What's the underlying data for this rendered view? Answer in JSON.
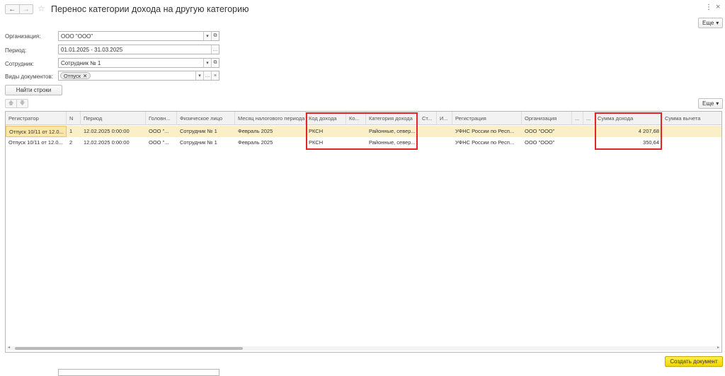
{
  "header": {
    "title": "Перенос категории дохода на другую категорию",
    "more_label": "Еще"
  },
  "form": {
    "organization": {
      "label": "Организация:",
      "value": "ООО \"ООО\""
    },
    "period": {
      "label": "Период:",
      "value": "01.01.2025 - 31.03.2025"
    },
    "employee": {
      "label": "Сотрудник:",
      "value": "Сотрудник № 1"
    },
    "doc_types": {
      "label": "Виды документов:",
      "tag": "Отпуск"
    }
  },
  "find_button": "Найти строки",
  "table_more_label": "Еще",
  "table": {
    "columns": [
      "Регистратор",
      "N",
      "Период",
      "Головн...",
      "Физическое лицо",
      "Месяц налогового периода",
      "Код дохода",
      "Ко...",
      "Категория дохода",
      "Ст...",
      "И...",
      "Регистрация",
      "Организация",
      "...",
      "...",
      "Сумма дохода",
      "Сумма вычета"
    ],
    "rows": [
      [
        "Отпуск 10/11 от 12.0...",
        "1",
        "12.02.2025 0:00:00",
        "ООО \"...",
        "Сотрудник № 1",
        "Февраль 2025",
        "РКСН",
        "",
        "Районные, север...",
        "",
        "",
        "УФНС России  по  Респ...",
        "ООО \"ООО\"",
        "",
        "",
        "4 207,68",
        ""
      ],
      [
        "Отпуск 10/11 от 12.0...",
        "2",
        "12.02.2025 0:00:00",
        "ООО \"...",
        "Сотрудник № 1",
        "Февраль 2025",
        "РКСН",
        "",
        "Районные, север...",
        "",
        "",
        "УФНС России  по  Респ...",
        "ООО \"ООО\"",
        "",
        "",
        "350,64",
        ""
      ]
    ]
  },
  "create_button": "Создать документ",
  "colors": {
    "accent_yellow": "#f4d400",
    "selected_row": "#fbefc7",
    "highlight_red": "#e2242b"
  }
}
